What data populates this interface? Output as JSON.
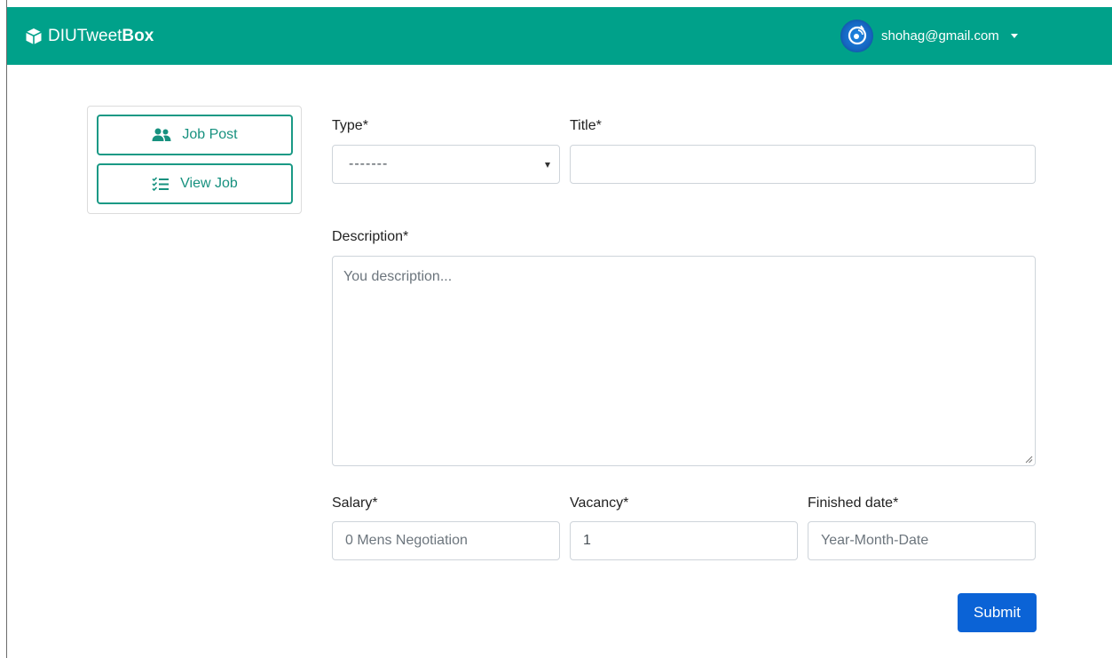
{
  "navbar": {
    "brand_light": "DIUTweet",
    "brand_bold": "Box",
    "user_email": "shohag@gmail.com",
    "background_color": "#00a18a"
  },
  "sidebar": {
    "items": [
      {
        "label": "Job Post",
        "icon": "users-icon"
      },
      {
        "label": "View Job",
        "icon": "list-check-icon"
      }
    ],
    "accent_color": "#1a9985"
  },
  "form": {
    "type": {
      "label": "Type*",
      "value": "-------"
    },
    "title": {
      "label": "Title*",
      "value": ""
    },
    "description": {
      "label": "Description*",
      "placeholder": "You description..."
    },
    "salary": {
      "label": "Salary*",
      "placeholder": "0 Mens Negotiation"
    },
    "vacancy": {
      "label": "Vacancy*",
      "value": "1"
    },
    "finished_date": {
      "label": "Finished date*",
      "placeholder": "Year-Month-Date"
    },
    "submit_label": "Submit",
    "submit_color": "#0b63d6"
  }
}
